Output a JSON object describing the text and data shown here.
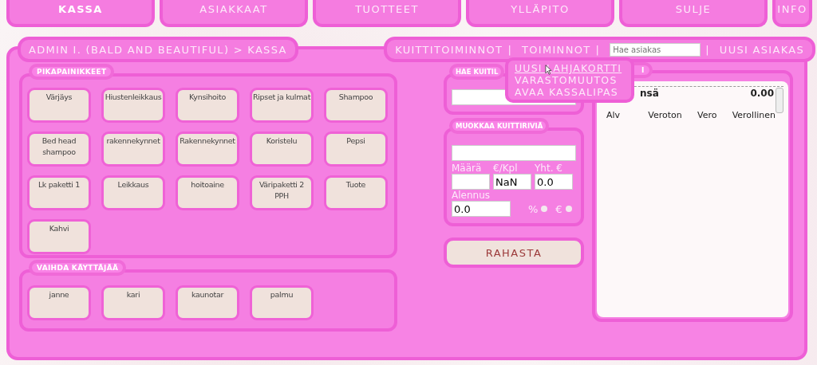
{
  "nav_tabs": [
    {
      "label": "KASSA",
      "selected": true
    },
    {
      "label": "ASIAKKAAT",
      "selected": false
    },
    {
      "label": "TUOTTEET",
      "selected": false
    },
    {
      "label": "YLLÄPITO",
      "selected": false
    },
    {
      "label": "SULJE",
      "selected": false
    },
    {
      "label": "INFO",
      "selected": false
    }
  ],
  "breadcrumb": "ADMIN I. (BALD AND BEAUTIFUL) > KASSA",
  "toolbar": [
    {
      "kind": "link",
      "text": "KUITTITOIMINNOT"
    },
    {
      "kind": "separator",
      "text": "|"
    },
    {
      "kind": "link",
      "text": "TOIMINNOT"
    },
    {
      "kind": "separator",
      "text": "|"
    },
    {
      "kind": "search",
      "placeholder": "Hae asiakas"
    },
    {
      "kind": "separator",
      "text": "|"
    },
    {
      "kind": "link",
      "text": "UUSI ASIAKAS"
    }
  ],
  "dropdown": [
    {
      "label": "UUSI LAHJAKORTTI",
      "hovered": true
    },
    {
      "label": "VARASTOMUUTOS",
      "hovered": false
    },
    {
      "label": "AVAA KASSALIPAS",
      "hovered": false
    }
  ],
  "quick_buttons": {
    "title": "PIKAPAINIKKEET",
    "items": [
      "Värjäys",
      "Hiustenleikkaus",
      "Kynsihoito",
      "Ripset ja kulmat",
      "Shampoo",
      "Bed head shampoo",
      "rakennekynnet",
      "Rakennekynnet",
      "Koristelu",
      "Pepsi",
      "Lk paketti 1",
      "Leikkaus",
      "hoitoaine",
      "Väripaketti 2 PPH",
      "Tuote",
      "Kahvi"
    ]
  },
  "switch_user": {
    "title": "VAIHDA KÄYTTÄJÄÄ",
    "users": [
      "janne",
      "kari",
      "kaunotar",
      "palmu"
    ]
  },
  "receipt_search": {
    "title": "HAE KUITIL"
  },
  "edit_row": {
    "title": "MUOKKAA KUITTIRIVIÄ",
    "quantity_label": "Määrä",
    "unit_price_label": "€/Kpl",
    "unit_price": "NaN",
    "total_label": "Yht. €",
    "total": "0.0",
    "discount_label": "Alennus",
    "discount": "0.0",
    "discount_types": [
      {
        "label": "%",
        "selected": false
      },
      {
        "label": "€",
        "selected": false
      }
    ]
  },
  "pay_button": "RAHASTA",
  "receipt": {
    "title": "I",
    "total_label": "nsä",
    "total": "0.00",
    "columns": [
      "Alv",
      "Veroton",
      "Vero",
      "Verollinen"
    ]
  }
}
